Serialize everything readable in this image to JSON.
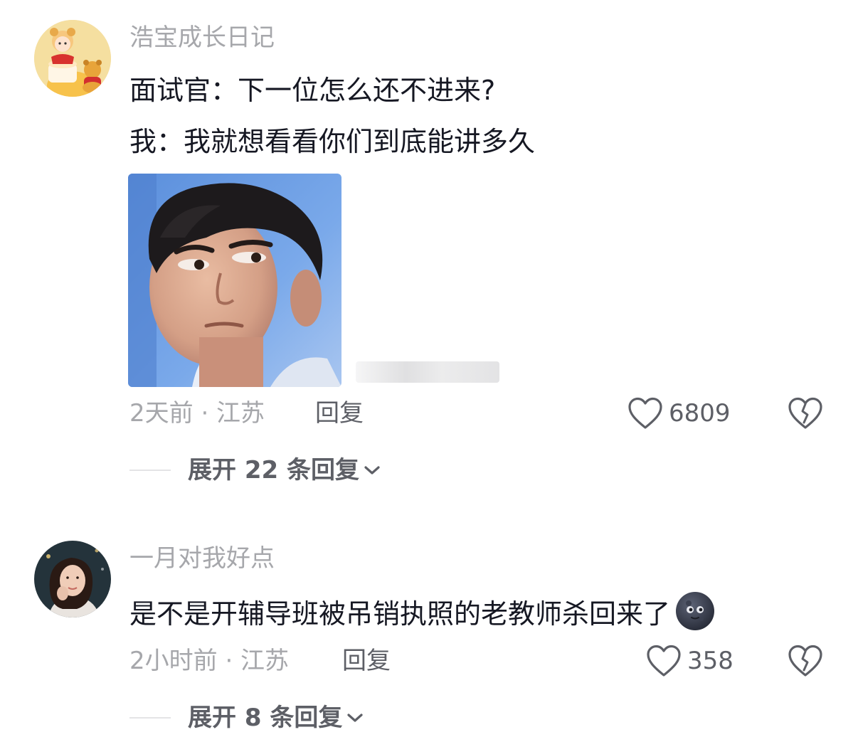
{
  "comments": [
    {
      "username": "浩宝成长日记",
      "lines": [
        "面试官：下一位怎么还不进来?",
        "我：我就想看看你们到底能讲多久"
      ],
      "has_image": true,
      "meta": "2天前 · 江苏",
      "reply_label": "回复",
      "likes": "6809",
      "expand_label": "展开 22 条回复"
    },
    {
      "username": "一月对我好点",
      "lines": [
        "是不是开辅导班被吊销执照的老教师杀回来了"
      ],
      "emoji": "new-moon-face-emoji",
      "meta": "2小时前 · 江苏",
      "reply_label": "回复",
      "likes": "358",
      "expand_label": "展开 8 条回复"
    }
  ],
  "icons": {
    "like": "heart-outline-icon",
    "dislike": "broken-heart-icon",
    "expand": "chevron-down-icon"
  },
  "colors": {
    "text_primary": "#161823",
    "text_secondary": "#a6a7ab",
    "text_action": "#5d5f66"
  }
}
